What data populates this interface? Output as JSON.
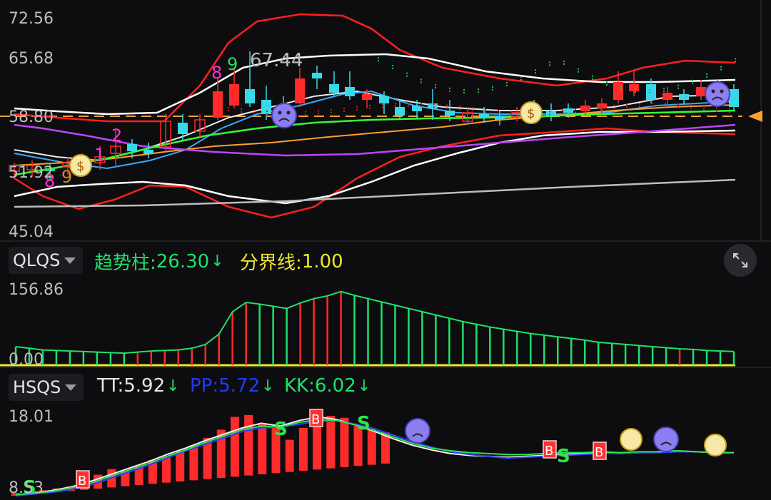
{
  "main": {
    "y_labels": [
      "72.56",
      "65.68",
      "58.80",
      "51.92",
      "45.04"
    ],
    "price_tag": "67.44",
    "seq_marks": [
      "8",
      "9",
      "2",
      "1",
      "8",
      "9"
    ],
    "ref_line_color": "#ff9f2e"
  },
  "qlqs": {
    "selector": "QLQS",
    "ind1_label": "趋势柱:",
    "ind1_value": "26.30",
    "ind1_arrow": "↓",
    "ind2_label": "分界线:",
    "ind2_value": "1.00",
    "y_top": "156.86",
    "y_bottom": "0.00",
    "expand_icon": "expand-icon"
  },
  "hsqs": {
    "selector": "HSQS",
    "tt_label": "TT:",
    "tt_value": "5.92",
    "tt_arrow": "↓",
    "pp_label": "PP:",
    "pp_value": "5.72",
    "pp_arrow": "↓",
    "kk_label": "KK:",
    "kk_value": "6.02",
    "kk_arrow": "↓",
    "y_top": "18.01",
    "y_bottom": "8.53",
    "markers": [
      "S",
      "B",
      "S",
      "B",
      "S",
      "S",
      "B",
      "B"
    ]
  },
  "colors": {
    "up": "#ff2a2a",
    "down": "#1fe06a",
    "cyan": "#39d8e8",
    "yellow": "#f0e62a"
  },
  "chart_data": [
    {
      "type": "candlestick",
      "ylim": [
        45.04,
        72.56
      ],
      "ticks": [
        72.56,
        65.68,
        58.8,
        51.92,
        45.04
      ],
      "ref_line": 60.2
    },
    {
      "type": "bar",
      "ylim": [
        0,
        156.86
      ],
      "values": [
        34,
        31,
        28,
        27,
        26,
        25,
        24,
        23,
        22,
        24,
        26,
        27,
        28,
        31,
        38,
        57,
        98,
        115,
        112,
        108,
        104,
        114,
        122,
        127,
        135,
        128,
        122,
        116,
        110,
        104,
        98,
        92,
        86,
        80,
        75,
        70,
        66,
        62,
        58,
        55,
        52,
        49,
        46,
        42,
        40,
        38,
        36,
        34,
        32,
        30,
        29,
        27,
        26,
        25
      ],
      "colors": [
        "g",
        "g",
        "g",
        "g",
        "g",
        "g",
        "g",
        "g",
        "g",
        "r",
        "r",
        "r",
        "r",
        "r",
        "r",
        "r",
        "r",
        "r",
        "g",
        "g",
        "g",
        "r",
        "r",
        "r",
        "r",
        "g",
        "g",
        "g",
        "g",
        "g",
        "g",
        "g",
        "g",
        "g",
        "g",
        "g",
        "g",
        "g",
        "g",
        "g",
        "g",
        "g",
        "g",
        "g",
        "g",
        "g",
        "g",
        "g",
        "g",
        "r",
        "g",
        "g",
        "g",
        "g"
      ],
      "threshold": 1.0
    },
    {
      "type": "bar",
      "ylim": [
        8.53,
        18.01
      ],
      "values": [
        8.9,
        9.0,
        9.2,
        9.4,
        9.6,
        10.1,
        10.9,
        11.5,
        11.3,
        11.8,
        12.5,
        12.8,
        13.5,
        14.1,
        14.9,
        15.8,
        17.2,
        17.4,
        16.4,
        16.2,
        14.7,
        16.0,
        17.5,
        17.3,
        17.1,
        16.2,
        15.9,
        15.5
      ],
      "series": [
        {
          "name": "TT",
          "values": [
            8.7,
            8.9,
            9.2,
            9.6,
            10.2,
            10.9,
            11.6,
            12.3,
            13.1,
            13.8,
            14.6,
            15.3,
            16.0,
            16.5,
            16.2,
            16.8,
            17.2,
            16.9,
            16.3,
            15.6,
            14.8,
            14.1,
            13.6,
            13.2,
            13.0,
            12.9,
            12.8,
            12.9,
            13.0,
            13.1,
            13.2,
            13.3,
            13.2,
            13.3,
            13.4,
            13.5,
            13.4,
            13.3,
            13.3
          ]
        },
        {
          "name": "PP",
          "values": [
            8.6,
            8.8,
            9.0,
            9.3,
            9.8,
            10.5,
            11.2,
            11.9,
            12.7,
            13.5,
            14.2,
            14.9,
            15.6,
            16.0,
            16.1,
            16.4,
            16.7,
            16.8,
            16.4,
            15.9,
            15.2,
            14.5,
            13.9,
            13.4,
            13.1,
            12.9,
            12.7,
            12.8,
            12.9,
            13.0,
            13.1,
            13.2,
            13.2,
            13.3,
            13.3,
            13.4,
            13.4,
            13.3,
            13.3
          ]
        },
        {
          "name": "KK",
          "values": [
            8.7,
            8.9,
            9.1,
            9.5,
            10.0,
            10.7,
            11.4,
            12.1,
            12.9,
            13.6,
            14.4,
            15.1,
            15.8,
            16.2,
            16.1,
            16.6,
            16.9,
            16.8,
            16.3,
            15.7,
            15.0,
            14.3,
            13.8,
            13.5,
            13.3,
            13.2,
            13.1,
            13.1,
            13.2,
            13.3,
            13.3,
            13.4,
            13.3,
            13.4,
            13.4,
            13.5,
            13.4,
            13.3,
            13.3
          ]
        }
      ]
    }
  ]
}
